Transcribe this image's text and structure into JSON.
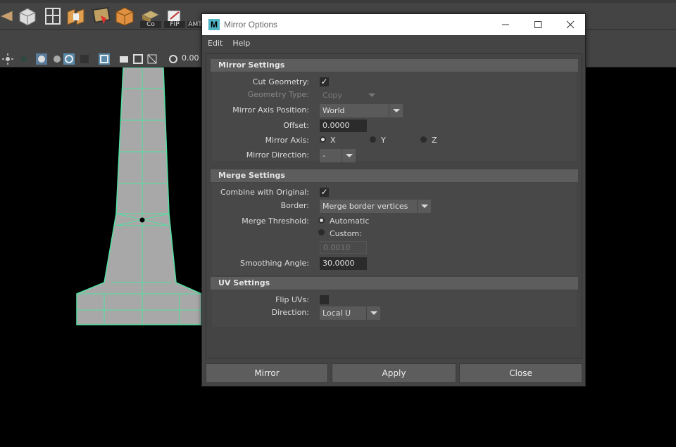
{
  "shelf": {
    "icons": [
      {
        "name": "cone-icon",
        "label": ""
      },
      {
        "name": "cube-select-icon",
        "label": ""
      },
      {
        "name": "multi-cut-icon",
        "label": ""
      },
      {
        "name": "extrude-icon",
        "label": ""
      },
      {
        "name": "bridge-icon",
        "label": ""
      },
      {
        "name": "bevel-box-icon",
        "label": ""
      },
      {
        "name": "combine-icon",
        "label": "Co"
      },
      {
        "name": "flip-icon",
        "label": "FIP"
      },
      {
        "name": "amt-icon",
        "label": "AMT"
      }
    ]
  },
  "viewport": {
    "field_value": "0.00",
    "mesh_color": "#52e0a0"
  },
  "dialog": {
    "title": "Mirror Options",
    "app_icon": "M",
    "menu": [
      "Edit",
      "Help"
    ],
    "mirror_settings": {
      "header": "Mirror Settings",
      "cut_geometry_label": "Cut Geometry:",
      "cut_geometry_checked": true,
      "geometry_type_label": "Geometry Type:",
      "geometry_type_value": "Copy",
      "mirror_axis_position_label": "Mirror Axis Position:",
      "mirror_axis_position_value": "World",
      "offset_label": "Offset:",
      "offset_value": "0.0000",
      "mirror_axis_label": "Mirror Axis:",
      "axis_x": "X",
      "axis_y": "Y",
      "axis_z": "Z",
      "mirror_axis_selected": "X",
      "mirror_direction_label": "Mirror Direction:",
      "mirror_direction_value": "-"
    },
    "merge_settings": {
      "header": "Merge Settings",
      "combine_label": "Combine with Original:",
      "combine_checked": true,
      "border_label": "Border:",
      "border_value": "Merge border vertices",
      "merge_threshold_label": "Merge Threshold:",
      "automatic_label": "Automatic",
      "custom_label": "Custom:",
      "threshold_selected": "Automatic",
      "custom_value": "0.0010",
      "smoothing_angle_label": "Smoothing Angle:",
      "smoothing_angle_value": "30.0000"
    },
    "uv_settings": {
      "header": "UV Settings",
      "flip_uvs_label": "Flip UVs:",
      "flip_uvs_checked": false,
      "direction_label": "Direction:",
      "direction_value": "Local U"
    },
    "buttons": {
      "mirror": "Mirror",
      "apply": "Apply",
      "close": "Close"
    }
  }
}
